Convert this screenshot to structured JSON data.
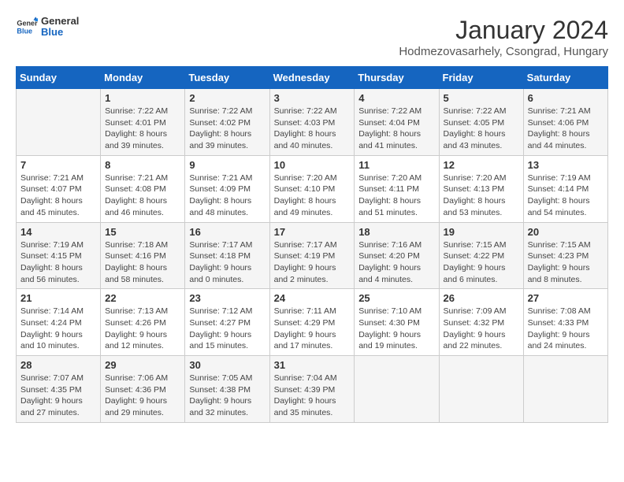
{
  "logo": {
    "text_general": "General",
    "text_blue": "Blue"
  },
  "title": "January 2024",
  "subtitle": "Hodmezovasarhely, Csongrad, Hungary",
  "days_of_week": [
    "Sunday",
    "Monday",
    "Tuesday",
    "Wednesday",
    "Thursday",
    "Friday",
    "Saturday"
  ],
  "weeks": [
    [
      {
        "day": "",
        "info": ""
      },
      {
        "day": "1",
        "info": "Sunrise: 7:22 AM\nSunset: 4:01 PM\nDaylight: 8 hours\nand 39 minutes."
      },
      {
        "day": "2",
        "info": "Sunrise: 7:22 AM\nSunset: 4:02 PM\nDaylight: 8 hours\nand 39 minutes."
      },
      {
        "day": "3",
        "info": "Sunrise: 7:22 AM\nSunset: 4:03 PM\nDaylight: 8 hours\nand 40 minutes."
      },
      {
        "day": "4",
        "info": "Sunrise: 7:22 AM\nSunset: 4:04 PM\nDaylight: 8 hours\nand 41 minutes."
      },
      {
        "day": "5",
        "info": "Sunrise: 7:22 AM\nSunset: 4:05 PM\nDaylight: 8 hours\nand 43 minutes."
      },
      {
        "day": "6",
        "info": "Sunrise: 7:21 AM\nSunset: 4:06 PM\nDaylight: 8 hours\nand 44 minutes."
      }
    ],
    [
      {
        "day": "7",
        "info": "Sunrise: 7:21 AM\nSunset: 4:07 PM\nDaylight: 8 hours\nand 45 minutes."
      },
      {
        "day": "8",
        "info": "Sunrise: 7:21 AM\nSunset: 4:08 PM\nDaylight: 8 hours\nand 46 minutes."
      },
      {
        "day": "9",
        "info": "Sunrise: 7:21 AM\nSunset: 4:09 PM\nDaylight: 8 hours\nand 48 minutes."
      },
      {
        "day": "10",
        "info": "Sunrise: 7:20 AM\nSunset: 4:10 PM\nDaylight: 8 hours\nand 49 minutes."
      },
      {
        "day": "11",
        "info": "Sunrise: 7:20 AM\nSunset: 4:11 PM\nDaylight: 8 hours\nand 51 minutes."
      },
      {
        "day": "12",
        "info": "Sunrise: 7:20 AM\nSunset: 4:13 PM\nDaylight: 8 hours\nand 53 minutes."
      },
      {
        "day": "13",
        "info": "Sunrise: 7:19 AM\nSunset: 4:14 PM\nDaylight: 8 hours\nand 54 minutes."
      }
    ],
    [
      {
        "day": "14",
        "info": "Sunrise: 7:19 AM\nSunset: 4:15 PM\nDaylight: 8 hours\nand 56 minutes."
      },
      {
        "day": "15",
        "info": "Sunrise: 7:18 AM\nSunset: 4:16 PM\nDaylight: 8 hours\nand 58 minutes."
      },
      {
        "day": "16",
        "info": "Sunrise: 7:17 AM\nSunset: 4:18 PM\nDaylight: 9 hours\nand 0 minutes."
      },
      {
        "day": "17",
        "info": "Sunrise: 7:17 AM\nSunset: 4:19 PM\nDaylight: 9 hours\nand 2 minutes."
      },
      {
        "day": "18",
        "info": "Sunrise: 7:16 AM\nSunset: 4:20 PM\nDaylight: 9 hours\nand 4 minutes."
      },
      {
        "day": "19",
        "info": "Sunrise: 7:15 AM\nSunset: 4:22 PM\nDaylight: 9 hours\nand 6 minutes."
      },
      {
        "day": "20",
        "info": "Sunrise: 7:15 AM\nSunset: 4:23 PM\nDaylight: 9 hours\nand 8 minutes."
      }
    ],
    [
      {
        "day": "21",
        "info": "Sunrise: 7:14 AM\nSunset: 4:24 PM\nDaylight: 9 hours\nand 10 minutes."
      },
      {
        "day": "22",
        "info": "Sunrise: 7:13 AM\nSunset: 4:26 PM\nDaylight: 9 hours\nand 12 minutes."
      },
      {
        "day": "23",
        "info": "Sunrise: 7:12 AM\nSunset: 4:27 PM\nDaylight: 9 hours\nand 15 minutes."
      },
      {
        "day": "24",
        "info": "Sunrise: 7:11 AM\nSunset: 4:29 PM\nDaylight: 9 hours\nand 17 minutes."
      },
      {
        "day": "25",
        "info": "Sunrise: 7:10 AM\nSunset: 4:30 PM\nDaylight: 9 hours\nand 19 minutes."
      },
      {
        "day": "26",
        "info": "Sunrise: 7:09 AM\nSunset: 4:32 PM\nDaylight: 9 hours\nand 22 minutes."
      },
      {
        "day": "27",
        "info": "Sunrise: 7:08 AM\nSunset: 4:33 PM\nDaylight: 9 hours\nand 24 minutes."
      }
    ],
    [
      {
        "day": "28",
        "info": "Sunrise: 7:07 AM\nSunset: 4:35 PM\nDaylight: 9 hours\nand 27 minutes."
      },
      {
        "day": "29",
        "info": "Sunrise: 7:06 AM\nSunset: 4:36 PM\nDaylight: 9 hours\nand 29 minutes."
      },
      {
        "day": "30",
        "info": "Sunrise: 7:05 AM\nSunset: 4:38 PM\nDaylight: 9 hours\nand 32 minutes."
      },
      {
        "day": "31",
        "info": "Sunrise: 7:04 AM\nSunset: 4:39 PM\nDaylight: 9 hours\nand 35 minutes."
      },
      {
        "day": "",
        "info": ""
      },
      {
        "day": "",
        "info": ""
      },
      {
        "day": "",
        "info": ""
      }
    ]
  ]
}
